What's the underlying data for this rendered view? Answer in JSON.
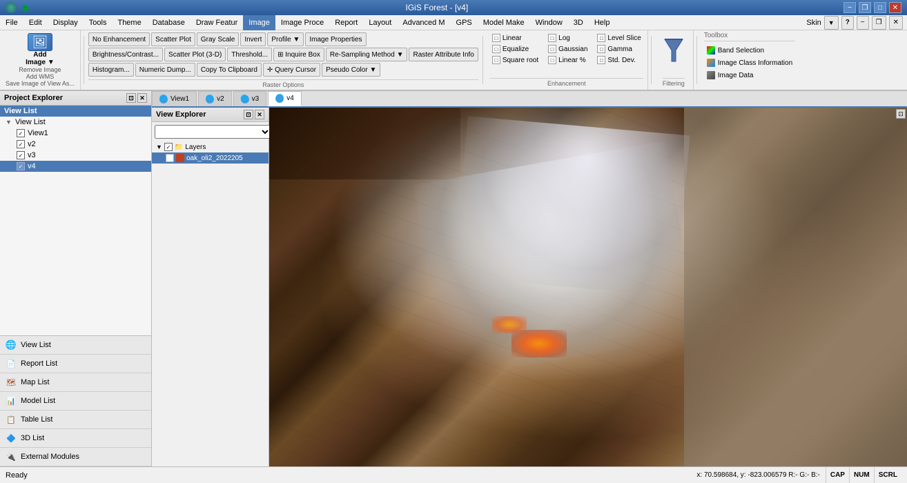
{
  "app": {
    "title": "IGiS Forest - [v4]",
    "icon": "🌲"
  },
  "titlebar": {
    "minimize": "−",
    "maximize": "□",
    "close": "✕",
    "restore": "❐"
  },
  "menubar": {
    "items": [
      "File",
      "Edit",
      "Display",
      "Tools",
      "Theme",
      "Database",
      "Draw Featur",
      "Image",
      "Image Proce",
      "Report",
      "Layout",
      "Advanced M",
      "GPS",
      "Model Make",
      "Window",
      "3D",
      "Help"
    ],
    "active": "Image",
    "skin_label": "Skin",
    "skin_dropdown": "▼"
  },
  "toolbar": {
    "add_image": {
      "label": "Add\nImage ▼",
      "icon": "🖼",
      "remove": "Remove Image",
      "add_wms": "Add WMS",
      "save": "Save Image of View As..."
    },
    "raster_options_label": "Raster Options",
    "enhancement_label": "Enhancement",
    "filtering_label": "Filtering",
    "toolbox_label": "Toolbox",
    "image_section": {
      "no_enhance": "No Enhancement",
      "brightness": "Brightness/Contrast...",
      "histogram": "Histogram...",
      "scatter_plot": "Scatter Plot",
      "scatter_3d": "Scatter Plot (3-D)",
      "numeric_dump": "Numeric Dump...",
      "gray_scale": "Gray Scale",
      "threshold": "Threshold...",
      "copy_clipboard": "Copy To Clipboard",
      "invert": "Invert",
      "profile": "Profile ▼",
      "image_properties": "Image Properties",
      "inquire_box": "⊞ Inquire Box",
      "resampling": "Re-Sampling Method ▼",
      "raster_attr": "Raster Attribute Info",
      "query_cursor": "✛ Query Cursor",
      "pseudo_color": "Pseudo Color ▼"
    },
    "enhancement": {
      "linear": "Linear",
      "log": "Log",
      "level_slice": "Level Slice",
      "equalize": "Equalize",
      "gaussian": "Gaussian",
      "gamma": "Gamma",
      "square_root": "Square root",
      "linear_pct": "Linear %",
      "std_dev": "Std. Dev."
    },
    "filtering": "Filtering",
    "toolbox": {
      "band_selection": "Band Selection",
      "image_class_info": "Image Class Information",
      "image_data": "Image Data"
    }
  },
  "project_explorer": {
    "title": "Project Explorer",
    "view_list_header": "View List",
    "tree": {
      "root": "View List",
      "items": [
        {
          "label": "View1",
          "checked": true
        },
        {
          "label": "v2",
          "checked": true
        },
        {
          "label": "v3",
          "checked": true
        },
        {
          "label": "v4",
          "checked": true,
          "active": true
        }
      ]
    },
    "nav_buttons": [
      {
        "label": "View List",
        "icon": "🌐"
      },
      {
        "label": "Report List",
        "icon": "📄"
      },
      {
        "label": "Map List",
        "icon": "🗺"
      },
      {
        "label": "Model List",
        "icon": "📊"
      },
      {
        "label": "Table List",
        "icon": "📋"
      },
      {
        "label": "3D List",
        "icon": "🔷"
      },
      {
        "label": "External Modules",
        "icon": "🔌"
      }
    ]
  },
  "view_explorer": {
    "title": "View Explorer",
    "layers_label": "Layers",
    "layer_name": "oak_oli2_2022205",
    "dropdown_placeholder": ""
  },
  "view_tabs": [
    {
      "label": "View1",
      "active": false
    },
    {
      "label": "v2",
      "active": false
    },
    {
      "label": "v3",
      "active": false
    },
    {
      "label": "v4",
      "active": true
    }
  ],
  "statusbar": {
    "ready": "Ready",
    "coords": "x: 70.598684, y: -823.006579 R:- G:- B:-",
    "cap": "CAP",
    "num": "NUM",
    "scrl": "SCRL"
  }
}
